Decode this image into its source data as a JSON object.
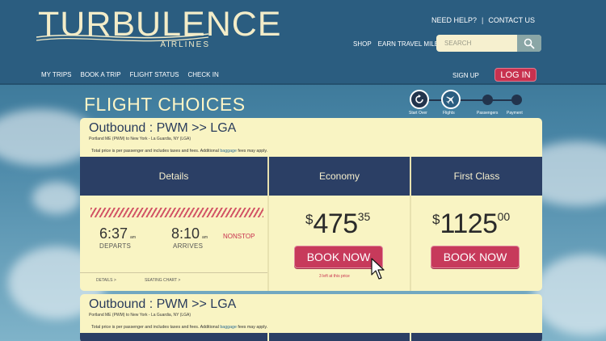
{
  "brand": {
    "name": "TURBULENCE",
    "subtitle": "AIRLINES"
  },
  "utility": {
    "help": "NEED HELP?",
    "separator": "|",
    "contact": "CONTACT US"
  },
  "top_links": [
    "SHOP",
    "EARN TRAVEL MILES"
  ],
  "search": {
    "placeholder": "SEARCH",
    "value": ""
  },
  "nav": [
    "MY TRIPS",
    "BOOK A TRIP",
    "FLIGHT STATUS",
    "CHECK IN"
  ],
  "account": {
    "signup": "SIGN UP",
    "login": "LOG IN"
  },
  "page_title": "FLIGHT CHOICES",
  "progress": {
    "steps": [
      {
        "label": "Start Over",
        "icon": "restart-icon"
      },
      {
        "label": "Flights",
        "icon": "airplane-icon"
      },
      {
        "label": "Passengers",
        "icon": "dot"
      },
      {
        "label": "Payment",
        "icon": "dot"
      }
    ],
    "current": "Flights"
  },
  "columns": {
    "details": "Details",
    "economy": "Economy",
    "first_class": "First Class"
  },
  "flights": [
    {
      "title": "Outbound : PWM >> LGA",
      "route": "Portland ME (PWM) to New York - La Guardia, NY (LGA)",
      "note_prefix": "Total price is per passenger and includes taxes and fees. Additional ",
      "note_link": "baggage",
      "note_suffix": " fees may apply.",
      "depart_time": "6:37",
      "depart_ampm": "am",
      "depart_label": "DEPARTS",
      "arrive_time": "8:10",
      "arrive_ampm": "am",
      "arrive_label": "ARRIVES",
      "stops": "NONSTOP",
      "details_link": "DETAILS >",
      "seating_link": "SEATING CHART >",
      "economy": {
        "currency": "$",
        "whole": "475",
        "cents": "35",
        "button": "BOOK NOW",
        "availability": "3 left at this price"
      },
      "first_class": {
        "currency": "$",
        "whole": "1125",
        "cents": "00",
        "button": "BOOK NOW"
      }
    },
    {
      "title": "Outbound : PWM >> LGA",
      "route": "Portland ME (PWM) to New York - La Guardia, NY (LGA)",
      "note_prefix": "Total price is per passenger and includes taxes and fees. Additional ",
      "note_link": "baggage",
      "note_suffix": " fees may apply."
    }
  ],
  "colors": {
    "header": "#2b5d80",
    "card": "#f9f4c3",
    "column_header": "#2b3f65",
    "accent": "#c73a5b"
  }
}
